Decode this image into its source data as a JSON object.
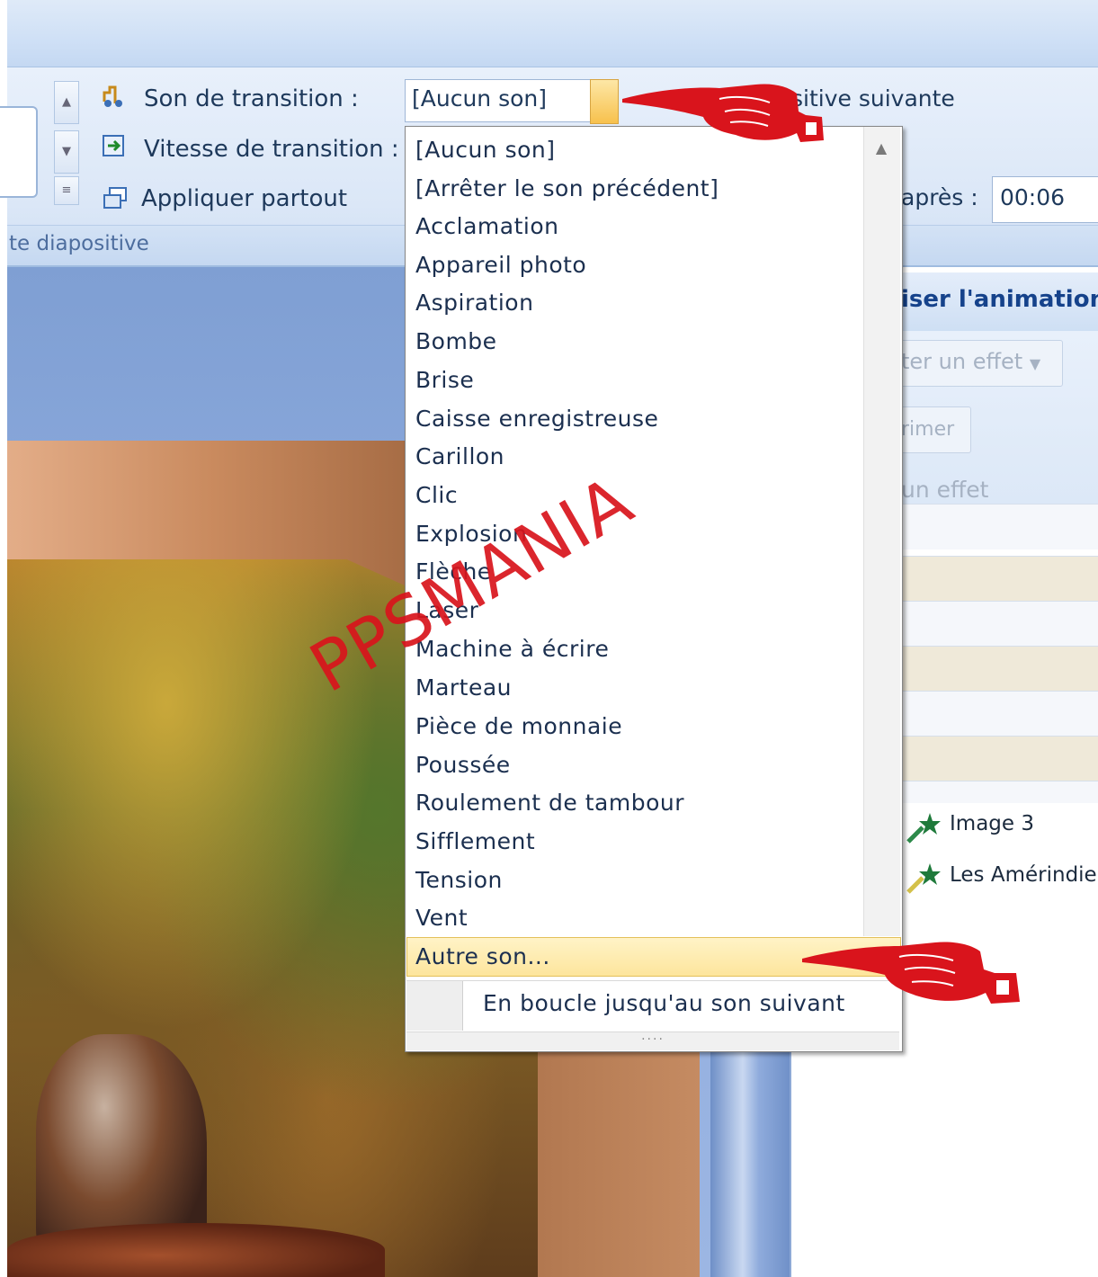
{
  "ribbon": {
    "sound_label": "Son de transition :",
    "speed_label": "Vitesse de transition :",
    "apply_all_label": "Appliquer partout",
    "group_label": "te diapositive",
    "sound_value": "[Aucun son]",
    "advance_next_label": "sitive suivante",
    "after_label": "après :",
    "after_value": "00:06"
  },
  "task_pane": {
    "title": "iser l'animation",
    "add_effect": "ter un effet",
    "delete": "rimer",
    "modify": "un effet",
    "items": [
      {
        "label": "Image 3",
        "icon": "green-star-icon"
      },
      {
        "label": "Les Amérindie",
        "icon": "yellow-star-icon"
      }
    ]
  },
  "dropdown": {
    "items": [
      "[Aucun son]",
      "[Arrêter le son précédent]",
      "Acclamation",
      "Appareil photo",
      "Aspiration",
      "Bombe",
      "Brise",
      "Caisse enregistreuse",
      "Carillon",
      "Clic",
      "Explosion",
      "Flèche",
      "Laser",
      "Machine à écrire",
      "Marteau",
      "Pièce de monnaie",
      "Poussée",
      "Roulement de tambour",
      "Sifflement",
      "Tension",
      "Vent"
    ],
    "other_sound": "Autre son...",
    "loop_label": "En boucle jusqu'au son suivant",
    "highlighted": "Autre son..."
  },
  "watermark": "PPSMANIA",
  "colors": {
    "accent": "#f7c14d",
    "hover": "#fde59c",
    "annotation": "#d9141c",
    "ribbon": "#dbe7f7"
  }
}
